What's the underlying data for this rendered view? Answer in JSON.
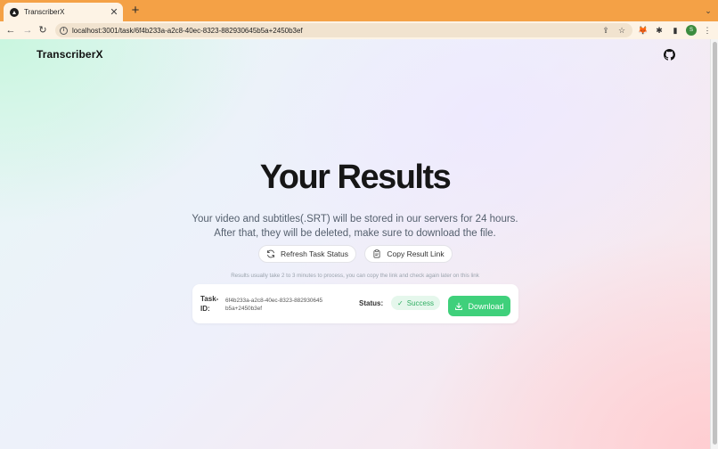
{
  "browser": {
    "tab_title": "TranscriberX",
    "url": "localhost:3001/task/6f4b233a-a2c8-40ec-8323-882930645b5a+2450b3ef",
    "profile_initial": "S"
  },
  "page": {
    "brand": "TranscriberX",
    "title": "Your Results",
    "subtitle_line1": "Your video and subtitles(.SRT) will be stored in our servers for 24 hours.",
    "subtitle_line2": "After that, they will be deleted, make sure to download the file.",
    "refresh_label": "Refresh Task Status",
    "copy_label": "Copy Result Link",
    "hint": "Results usually take 2 to 3 minutes to process, you can copy the link and check again later on this link",
    "task": {
      "id_label": "Task-ID:",
      "id_value": "6f4b233a-a2c8-40ec-8323-882930645b5a+2450b3ef",
      "status_label": "Status:",
      "status_value": "Success",
      "download_label": "Download"
    }
  },
  "colors": {
    "accent_green": "#3fd07b",
    "success_text": "#2fae62",
    "browser_frame": "#f4a146"
  }
}
